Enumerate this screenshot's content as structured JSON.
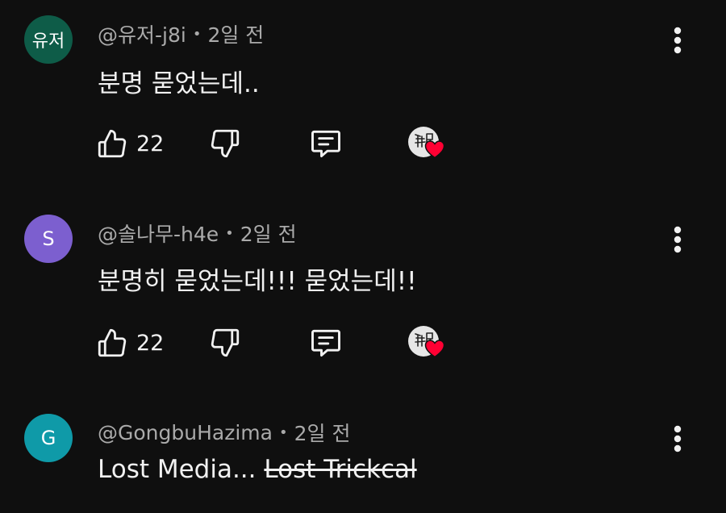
{
  "comments": [
    {
      "avatar_text": "유저",
      "avatar_color": "#0e5c48",
      "handle": "@유저-j8i",
      "separator": "•",
      "time": "2일 전",
      "text": "분명 묻었는데..",
      "likes": "22",
      "creator_heart": true
    },
    {
      "avatar_text": "S",
      "avatar_color": "#7c5fcf",
      "handle": "@솔나무-h4e",
      "separator": "•",
      "time": "2일 전",
      "text": "분명히 묻었는데!!! 묻었는데!!",
      "likes": "22",
      "creator_heart": true
    },
    {
      "avatar_text": "G",
      "avatar_color": "#0f9aa8",
      "handle": "@GongbuHazima",
      "separator": "•",
      "time": "2일 전",
      "text": "Lost Media...",
      "text_struck": "Lost Trickcal"
    }
  ],
  "icons": {
    "like": "thumbs-up-icon",
    "dislike": "thumbs-down-icon",
    "reply": "reply-icon",
    "more": "more-vert-icon",
    "heart": "creator-heart-icon"
  },
  "colors": {
    "background": "#0f0f0f",
    "primary_text": "#f1f1f1",
    "secondary_text": "#aaaaaa",
    "heart": "#ff0033"
  }
}
